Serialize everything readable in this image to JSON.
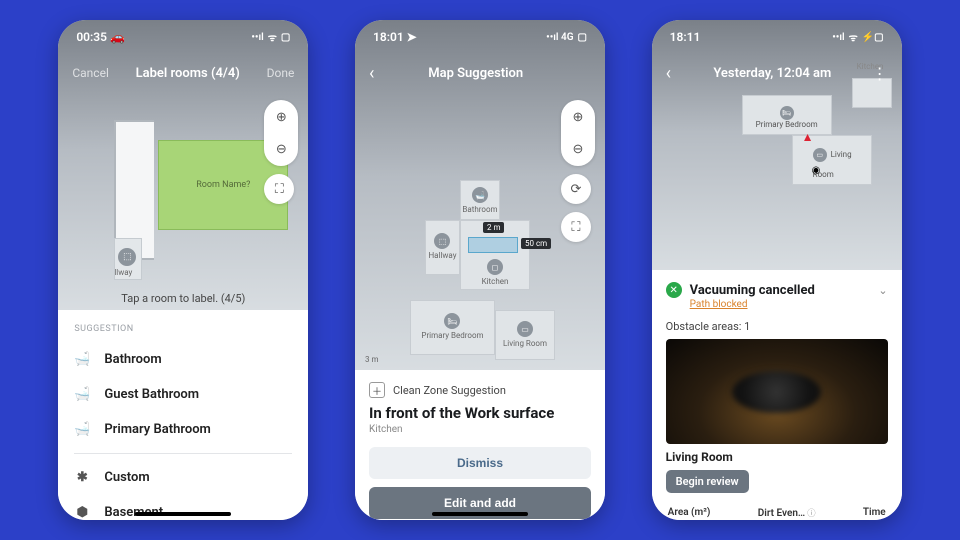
{
  "phone1": {
    "status": {
      "time": "00:35",
      "left_icon": "🚗",
      "signal": "••ıl",
      "wifi": "ᯤ",
      "batt": "▢"
    },
    "nav": {
      "cancel": "Cancel",
      "title": "Label rooms (4/4)",
      "done": "Done"
    },
    "map": {
      "room_placeholder": "Room Name?",
      "hint": "Tap a room to label. (4/5)",
      "hallway_label": "llway"
    },
    "controls": {
      "zoom_in": "⊕",
      "zoom_out": "⊖",
      "fit": "⛶"
    },
    "sheet": {
      "section": "SUGGESTION",
      "items": [
        {
          "icon": "🛁",
          "label": "Bathroom"
        },
        {
          "icon": "🛁",
          "label": "Guest Bathroom"
        },
        {
          "icon": "🛁",
          "label": "Primary Bathroom"
        }
      ],
      "extra": [
        {
          "icon": "✱",
          "label": "Custom"
        },
        {
          "icon": "⬢",
          "label": "Basement"
        }
      ]
    }
  },
  "phone2": {
    "status": {
      "time": "18:01",
      "left_icon": "➤",
      "net": "••ıl 4G",
      "batt": "▢"
    },
    "nav": {
      "title": "Map Suggestion"
    },
    "controls": {
      "zoom_in": "⊕",
      "zoom_out": "⊖",
      "rotate": "⟳",
      "fit": "⛶"
    },
    "map": {
      "rooms": {
        "bathroom": "Bathroom",
        "hallway": "Hallway",
        "kitchen": "Kitchen",
        "primary": "Primary Bedroom",
        "living": "Living Room"
      },
      "dim_w": "2 m",
      "dim_h": "50 cm",
      "scale": "3 m"
    },
    "sheet": {
      "badge": "Clean Zone Suggestion",
      "title": "In front of the Work surface",
      "subtitle": "Kitchen",
      "dismiss": "Dismiss",
      "edit": "Edit and add"
    }
  },
  "phone3": {
    "status": {
      "time": "18:11",
      "signal": "••ıl",
      "wifi": "ᯤ",
      "batt": "⚡▢"
    },
    "nav": {
      "title": "Yesterday, 12:04 am"
    },
    "map": {
      "primary": "Primary Bedroom",
      "living": "Living Room",
      "kitchen": "Kitchen"
    },
    "sheet": {
      "status_title": "Vacuuming cancelled",
      "reason": "Path blocked",
      "obstacle": "Obstacle areas: 1",
      "location": "Living Room",
      "review": "Begin review",
      "cols": {
        "area": "Area (m²)",
        "dirt": "Dirt Even…",
        "time": "Time"
      }
    }
  }
}
